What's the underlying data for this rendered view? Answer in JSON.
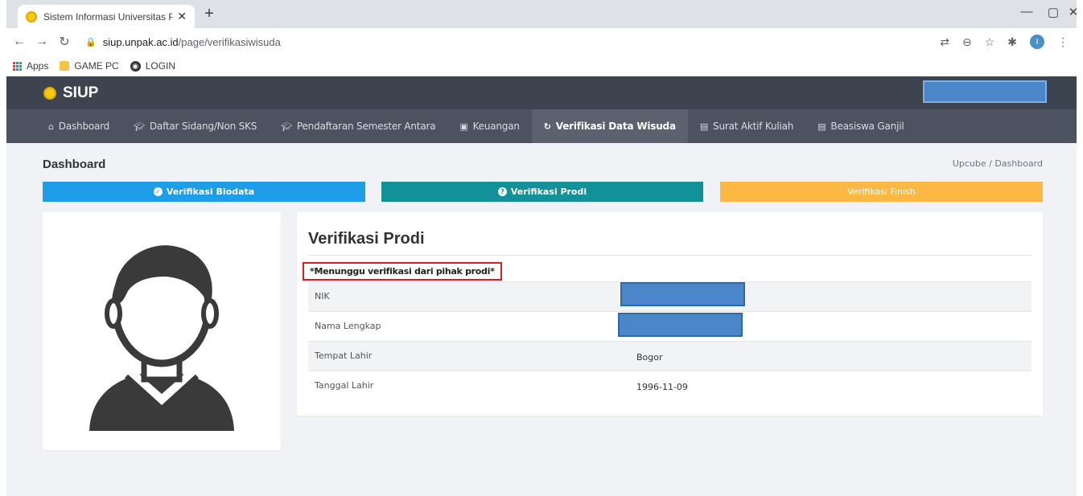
{
  "browser": {
    "tab_title": "Sistem Informasi Universitas Pak",
    "tab_close": "✕",
    "new_tab": "+",
    "url_host": "siup.unpak.ac.id",
    "url_path": "/page/verifikasiwisuda",
    "bookmarks": [
      "Apps",
      "GAME PC",
      "LOGIN"
    ],
    "profile_initial": "I"
  },
  "app": {
    "brand": "SIUP",
    "nav": [
      {
        "label": "Dashboard",
        "icon": "home-icon"
      },
      {
        "label": "Daftar Sidang/Non SKS",
        "icon": "graduation-cap-icon"
      },
      {
        "label": "Pendaftaran Semester Antara",
        "icon": "graduation-cap-icon"
      },
      {
        "label": "Keuangan",
        "icon": "money-icon"
      },
      {
        "label": "Verifikasi Data Wisuda",
        "icon": "refresh-icon",
        "active": true
      },
      {
        "label": "Surat Aktif Kuliah",
        "icon": "document-icon"
      },
      {
        "label": "Beasiswa Ganjil",
        "icon": "document-icon"
      }
    ]
  },
  "page": {
    "title": "Dashboard",
    "breadcrumb": "Upcube / Dashboard"
  },
  "steps": [
    {
      "label": "Verifikasi Biodata",
      "icon": "check-circle-icon",
      "color": "#1e9de9"
    },
    {
      "label": "Verifikasi Prodi",
      "icon": "question-circle-icon",
      "color": "#139199"
    },
    {
      "label": "Verifikasi Finish",
      "color": "#fbb944"
    }
  ],
  "info": {
    "heading": "Verifikasi Prodi",
    "status_note": "*Menunggu verifikasi dari pihak prodi*",
    "rows": [
      {
        "label": "NIK",
        "value": ""
      },
      {
        "label": "Nama Lengkap",
        "value": ""
      },
      {
        "label": "Tempat Lahir",
        "value": "Bogor"
      },
      {
        "label": "Tanggal Lahir",
        "value": "1996-11-09"
      }
    ]
  }
}
